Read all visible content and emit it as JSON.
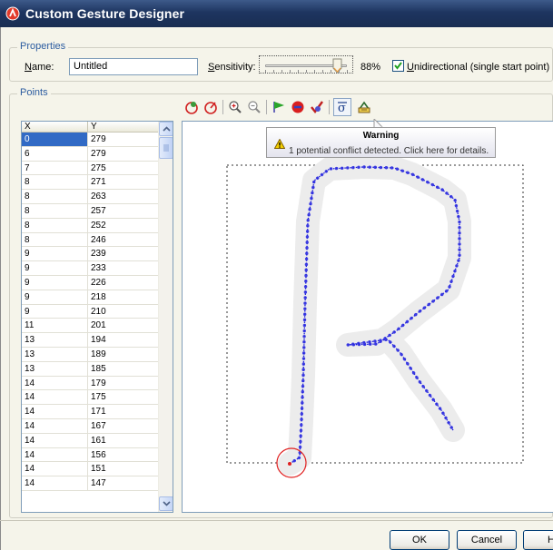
{
  "window": {
    "title": "Custom Gesture Designer",
    "icon": "gesture-app-icon"
  },
  "properties": {
    "group_label": "Properties",
    "name_label": "Name:",
    "name_mnemonic": "N",
    "name_label_rest": "ame:",
    "name_value": "Untitled",
    "sensitivity_mnemonic": "S",
    "sensitivity_label_rest": "ensitivity:",
    "sensitivity_value": 88,
    "sensitivity_display": "88%",
    "unidirectional_checked": true,
    "unidirectional_mnemonic": "U",
    "unidirectional_label_rest": "nidirectional (single start point)"
  },
  "points": {
    "group_label": "Points",
    "columns": [
      "X",
      "Y"
    ],
    "rows": [
      [
        "0",
        "279"
      ],
      [
        "6",
        "279"
      ],
      [
        "7",
        "275"
      ],
      [
        "8",
        "271"
      ],
      [
        "8",
        "263"
      ],
      [
        "8",
        "257"
      ],
      [
        "8",
        "252"
      ],
      [
        "8",
        "246"
      ],
      [
        "9",
        "239"
      ],
      [
        "9",
        "233"
      ],
      [
        "9",
        "226"
      ],
      [
        "9",
        "218"
      ],
      [
        "9",
        "210"
      ],
      [
        "11",
        "201"
      ],
      [
        "13",
        "194"
      ],
      [
        "13",
        "189"
      ],
      [
        "13",
        "185"
      ],
      [
        "14",
        "179"
      ],
      [
        "14",
        "175"
      ],
      [
        "14",
        "171"
      ],
      [
        "14",
        "167"
      ],
      [
        "14",
        "161"
      ],
      [
        "14",
        "156"
      ],
      [
        "14",
        "151"
      ],
      [
        "14",
        "147"
      ]
    ],
    "selected_row": 0
  },
  "toolbar": {
    "buttons": [
      "add-point-icon",
      "remove-point-icon",
      "zoom-in-icon",
      "zoom-out-icon",
      "start-flag-icon",
      "stop-icon",
      "verify-icon",
      "sigma-icon",
      "conflict-scan-icon"
    ]
  },
  "warning": {
    "title": "Warning",
    "body": "1 potential conflict detected. Click here for details."
  },
  "buttons": {
    "ok": "OK",
    "cancel": "Cancel",
    "help": "H"
  },
  "colors": {
    "title_bar": "#1e3560",
    "accent": "#2c5ca0",
    "stroke": "#1a1adc",
    "selected": "#316ac5",
    "start_marker": "#e02020"
  }
}
